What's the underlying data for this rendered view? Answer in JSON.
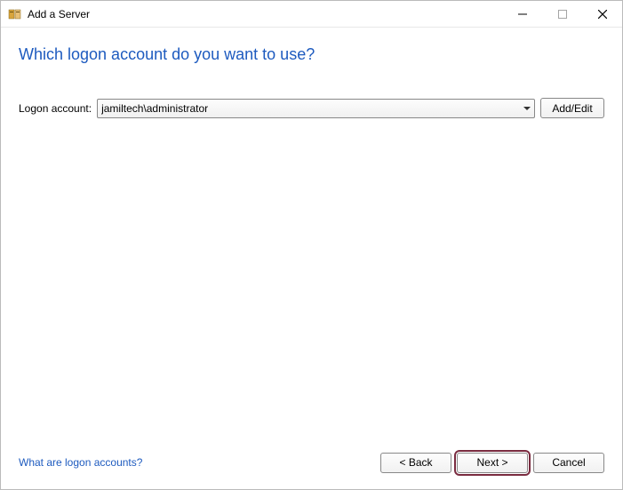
{
  "window": {
    "title": "Add a Server"
  },
  "main": {
    "heading": "Which logon account do you want to use?",
    "logon_label": "Logon account:",
    "logon_selected": "jamiltech\\administrator",
    "add_edit_label": "Add/Edit"
  },
  "footer": {
    "help_link": "What are logon accounts?",
    "back_label": "< Back",
    "next_label": "Next >",
    "cancel_label": "Cancel"
  }
}
